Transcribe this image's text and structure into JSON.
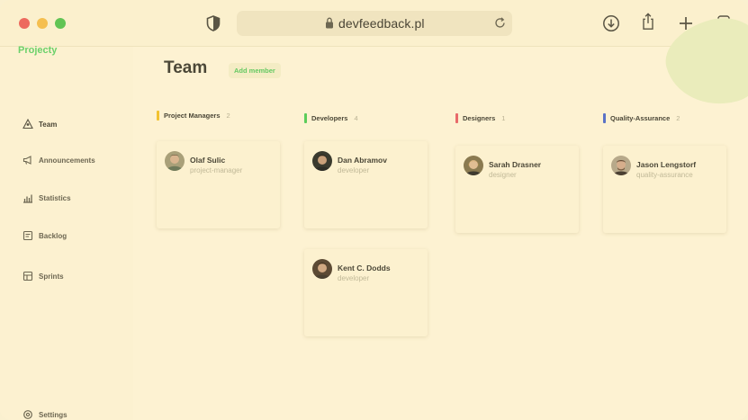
{
  "browser": {
    "url": "devfeedback.pl"
  },
  "sidebar": {
    "brand": "Projecty",
    "items": [
      {
        "label": "Team",
        "icon": "team-icon"
      },
      {
        "label": "Announcements",
        "icon": "megaphone-icon"
      },
      {
        "label": "Statistics",
        "icon": "statistics-icon"
      },
      {
        "label": "Backlog",
        "icon": "backlog-icon"
      },
      {
        "label": "Sprints",
        "icon": "sprints-icon"
      }
    ],
    "settings": {
      "label": "Settings",
      "icon": "gear-icon"
    }
  },
  "main": {
    "title": "Team",
    "add_member_label": "Add member",
    "columns": [
      {
        "title": "Project Managers",
        "count": "2",
        "color": "#f2c230",
        "members": [
          {
            "name": "Olaf Sulic",
            "role": "project-manager"
          }
        ]
      },
      {
        "title": "Developers",
        "count": "4",
        "color": "#5ccc5a",
        "members": [
          {
            "name": "Dan Abramov",
            "role": "developer"
          },
          {
            "name": "Kent C. Dodds",
            "role": "developer"
          }
        ]
      },
      {
        "title": "Designers",
        "count": "1",
        "color": "#e86a6a",
        "members": [
          {
            "name": "Sarah Drasner",
            "role": "designer"
          }
        ]
      },
      {
        "title": "Quality-Assurance",
        "count": "2",
        "color": "#5a72c6",
        "members": [
          {
            "name": "Jason Lengstorf",
            "role": "quality-assurance"
          }
        ]
      }
    ]
  },
  "colors": {
    "background": "#fcf1d0",
    "accent": "#6bd16a",
    "text": "#4b4737",
    "muted": "#c1b998"
  }
}
